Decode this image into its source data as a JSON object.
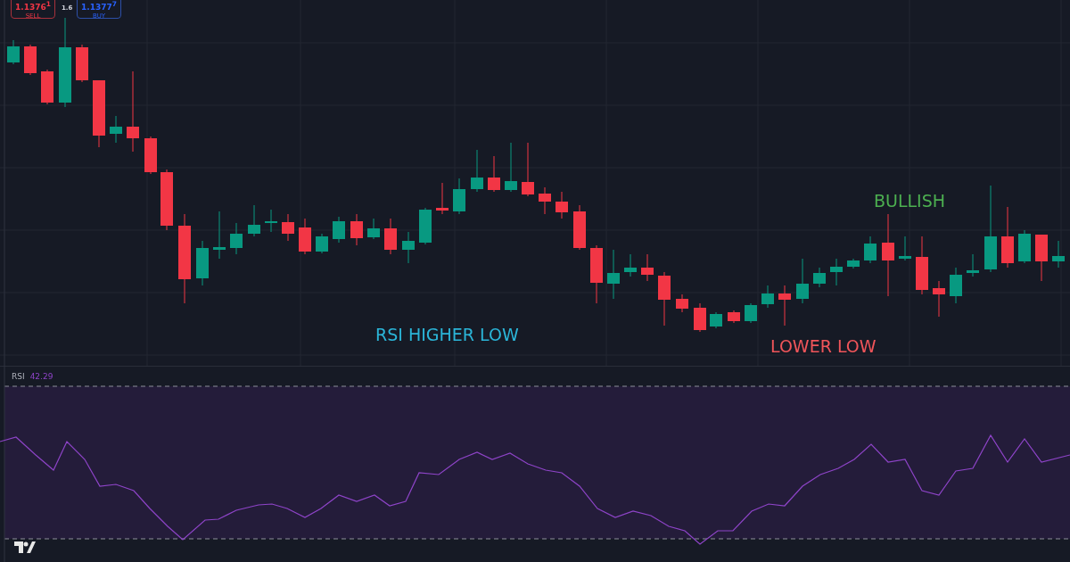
{
  "trade_buttons": [
    {
      "kind": "sell",
      "price": "1.1376$^{1}$",
      "label": "SELL"
    },
    {
      "kind": "buy",
      "price": "1.1377$^{7}$",
      "label": "BUY"
    }
  ],
  "spread": "1.6",
  "annotations": [
    {
      "text": "RSI HIGHER LOW",
      "color": "#2bb5d8"
    },
    {
      "text": "LOWER LOW",
      "color": "#f0555a"
    },
    {
      "text": "BULLISH",
      "color": "#4caf50"
    }
  ],
  "indicator": {
    "name": "RSI",
    "value": "42.29"
  }
}
